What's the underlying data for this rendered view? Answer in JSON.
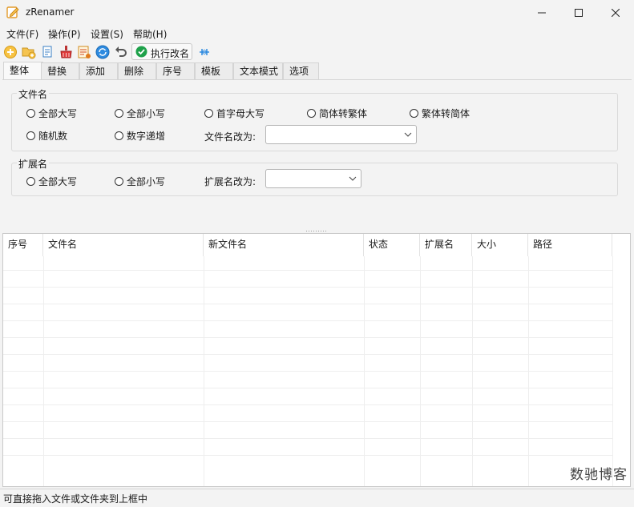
{
  "window": {
    "title": "zRenamer"
  },
  "menu": [
    "文件(F)",
    "操作(P)",
    "设置(S)",
    "帮助(H)"
  ],
  "toolbar": {
    "icons": [
      "add-file-icon",
      "add-folder-icon",
      "copy-icon",
      "clear-icon",
      "list-icon",
      "refresh-icon",
      "undo-icon",
      "pin-icon"
    ],
    "execute_label": "执行改名"
  },
  "tabs": [
    "整体",
    "替换",
    "添加",
    "删除",
    "序号",
    "模板",
    "文本模式",
    "选项"
  ],
  "active_tab": "整体",
  "filename_group": {
    "title": "文件名",
    "options": [
      "全部大写",
      "全部小写",
      "首字母大写",
      "简体转繁体",
      "繁体转简体",
      "随机数",
      "数字递增"
    ],
    "rename_label": "文件名改为:",
    "rename_value": ""
  },
  "extension_group": {
    "title": "扩展名",
    "options": [
      "全部大写",
      "全部小写"
    ],
    "rename_label": "扩展名改为:",
    "rename_value": ""
  },
  "table": {
    "columns": [
      "序号",
      "文件名",
      "新文件名",
      "状态",
      "扩展名",
      "大小",
      "路径"
    ],
    "rows": []
  },
  "status": "可直接拖入文件或文件夹到上框中",
  "watermark": "数驰博客"
}
